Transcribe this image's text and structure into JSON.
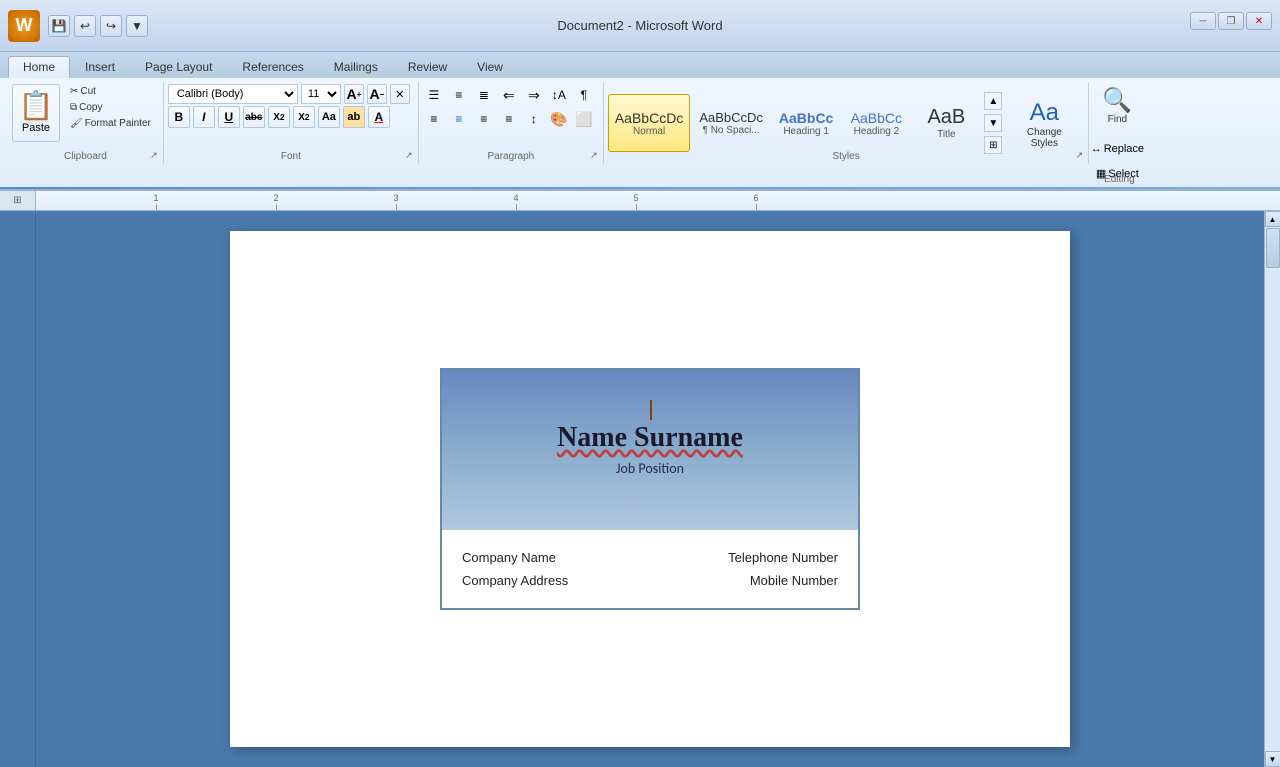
{
  "titlebar": {
    "title": "Document2 - Microsoft Word",
    "minimize": "─",
    "restore": "❐",
    "close": "✕"
  },
  "quickaccess": {
    "save": "💾",
    "undo": "↩",
    "redo": "↪",
    "arrow": "▼"
  },
  "tabs": [
    {
      "id": "home",
      "label": "Home",
      "active": true
    },
    {
      "id": "insert",
      "label": "Insert",
      "active": false
    },
    {
      "id": "pagelayout",
      "label": "Page Layout",
      "active": false
    },
    {
      "id": "references",
      "label": "References",
      "active": false
    },
    {
      "id": "mailings",
      "label": "Mailings",
      "active": false
    },
    {
      "id": "review",
      "label": "Review",
      "active": false
    },
    {
      "id": "view",
      "label": "View",
      "active": false
    }
  ],
  "ribbon": {
    "clipboard": {
      "label": "Clipboard",
      "paste": "Paste",
      "cut": "✂ Cut",
      "copy": "⧉ Copy",
      "format_painter": "🖌 Format Painter"
    },
    "font": {
      "label": "Font",
      "name": "Calibri (Body)",
      "size": "11",
      "grow": "A",
      "shrink": "A",
      "clear": "✕",
      "bold": "B",
      "italic": "I",
      "underline": "U",
      "strikethrough": "abc",
      "subscript": "X₂",
      "superscript": "X²",
      "change_case": "Aa",
      "highlight": "ab",
      "color": "A"
    },
    "paragraph": {
      "label": "Paragraph",
      "bullets": "☰",
      "numbering": "≡",
      "multilevel": "≣",
      "decrease_indent": "⇐",
      "increase_indent": "⇒",
      "sort": "↕",
      "show_hide": "¶",
      "align_left": "▤",
      "align_center": "▦",
      "align_right": "▧",
      "justify": "▥",
      "line_spacing": "↕",
      "shading": "🎨",
      "border": "⬜"
    },
    "styles": {
      "label": "Styles",
      "items": [
        {
          "id": "normal",
          "label": "AaBbCcDc",
          "name": "Normal",
          "active": true
        },
        {
          "id": "no-spacing",
          "label": "AaBbCcDc",
          "name": "¶ No Spaci..."
        },
        {
          "id": "heading1",
          "label": "AaBbCc",
          "name": "Heading 1"
        },
        {
          "id": "heading2",
          "label": "AaBbCc",
          "name": "Heading 2"
        },
        {
          "id": "title",
          "label": "AaB",
          "name": "Title"
        }
      ],
      "change": "Change\nStyles"
    },
    "editing": {
      "label": "Editing",
      "find": "Find",
      "replace": "Replace",
      "select": "Select"
    }
  },
  "card": {
    "name": "Name Surname",
    "position": "Job Position",
    "company": "Company Name",
    "address": "Company Address",
    "telephone": "Telephone Number",
    "mobile": "Mobile Number"
  }
}
